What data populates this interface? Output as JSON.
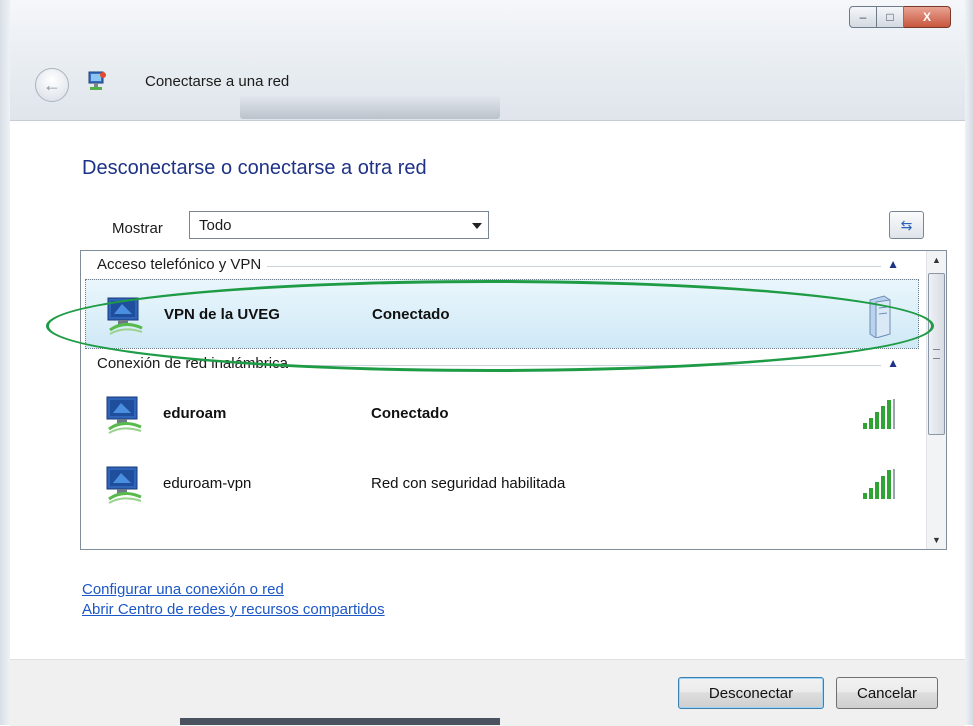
{
  "window": {
    "title": "Conectarse a una red",
    "controls": {
      "minimize": "–",
      "maximize": "□",
      "close": "X"
    }
  },
  "main": {
    "heading": "Desconectarse o conectarse a otra red",
    "show_label": "Mostrar",
    "show_value": "Todo",
    "refresh_icon": "refresh-icon"
  },
  "list": {
    "groups": [
      {
        "label": "Acceso telefónico y VPN",
        "items": [
          {
            "name": "VPN de la UVEG",
            "status": "Conectado",
            "selected": true,
            "bold": true,
            "icon": "vpn-server-icon"
          }
        ]
      },
      {
        "label": "Conexión de red inalámbrica",
        "items": [
          {
            "name": "eduroam",
            "status": "Conectado",
            "selected": false,
            "bold": true,
            "icon": "signal-strength-icon"
          },
          {
            "name": "eduroam-vpn",
            "status": "Red con seguridad habilitada",
            "selected": false,
            "bold": false,
            "icon": "signal-strength-icon"
          }
        ]
      }
    ]
  },
  "links": {
    "setup": "Configurar una conexión o red",
    "network_center": "Abrir Centro de redes y recursos compartidos"
  },
  "buttons": {
    "disconnect": "Desconectar",
    "cancel": "Cancelar"
  },
  "colors": {
    "heading": "#1e3287",
    "link": "#1c57c7",
    "highlight": "#1e9b45"
  }
}
